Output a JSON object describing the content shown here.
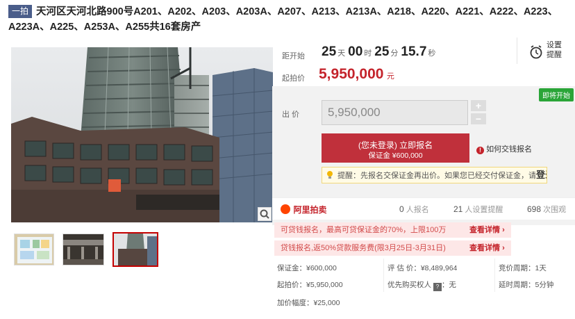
{
  "title": {
    "tag": "一拍",
    "text": "天河区天河北路900号A201、A202、A203、A203A、A207、A213、A213A、A218、A220、A221、A222、A223、A223A、A225、A253A、A255共16套房产"
  },
  "countdown": {
    "label": "距开始",
    "days": "25",
    "days_unit": "天",
    "hours": "00",
    "hours_unit": "时",
    "minutes": "25",
    "minutes_unit": "分",
    "seconds": "15.7",
    "seconds_unit": "秒"
  },
  "reminder": {
    "line1": "设置",
    "line2": "提醒"
  },
  "start_price": {
    "label": "起拍价",
    "value": "5,950,000",
    "unit": "元"
  },
  "status_tag": "即将开始",
  "bid": {
    "label": "出 价",
    "value": "5,950,000",
    "plus": "+",
    "minus": "−",
    "button_line1": "(您未登录) 立即报名",
    "button_line2": "保证金 ¥600,000",
    "how_to_pay": "如何交钱报名"
  },
  "notice": {
    "prefix": "提醒：先报名交保证金再出价。如果您已经交付保证金，请",
    "login": "登录"
  },
  "brand": "阿里拍卖",
  "stats": [
    {
      "num": "0",
      "label": "人报名"
    },
    {
      "num": "21",
      "label": "人设置提醒"
    },
    {
      "num": "698",
      "label": "次围观"
    }
  ],
  "promos": [
    {
      "text": "可贷钱报名，最高可贷保证金的70%，上限100万",
      "link": "查看详情"
    },
    {
      "text": "贷钱报名,返50%贷款服务费(限3月25日-3月31日)",
      "link": "查看详情"
    }
  ],
  "info": {
    "deposit": "保证金：¥600,000",
    "appraisal": "评 估 价：¥8,489,964",
    "bid_cycle": "竞价周期：1天",
    "start": "起拍价：¥5,950,000",
    "priority": "优先购买权人",
    "priority_value": "：无",
    "delay": "延时周期：5分钟",
    "increment": "加价幅度：¥25,000"
  },
  "colors": {
    "accent_red": "#c0303b",
    "price_red": "#c4232b",
    "green": "#2aa538"
  }
}
